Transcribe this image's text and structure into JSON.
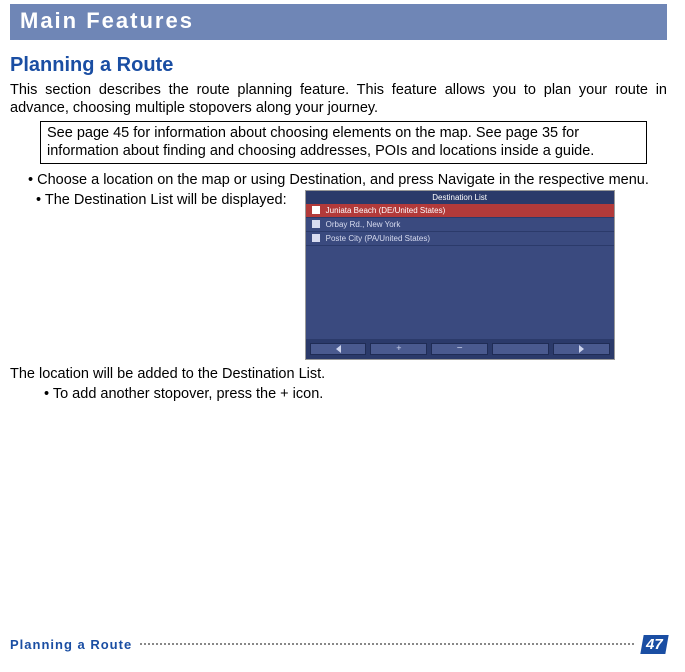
{
  "header": {
    "title": "Main Features"
  },
  "section": {
    "title": "Planning a Route",
    "intro": "This section describes the route planning feature. This feature allows you to plan your route in advance, choosing multiple stopovers along your journey.",
    "note": "See page 45 for information about choosing elements on the map. See page 35 for information about finding and choosing addresses, POIs and locations inside a guide.",
    "bullet_1": "• Choose a location on the map or using Destination, and press Navigate in the respective menu.",
    "bullet_2": "• The Destination List will be displayed:",
    "after_image": "The location will be added to the Destination List.",
    "bullet_3": "• To add another stopover, press the + icon."
  },
  "destination_list": {
    "title": "Destination List",
    "items": [
      "Juniata Beach (DE/United States)",
      "Orbay Rd., New York",
      "Poste City (PA/United States)"
    ]
  },
  "footer": {
    "label": "Planning a Route",
    "page": "47"
  }
}
